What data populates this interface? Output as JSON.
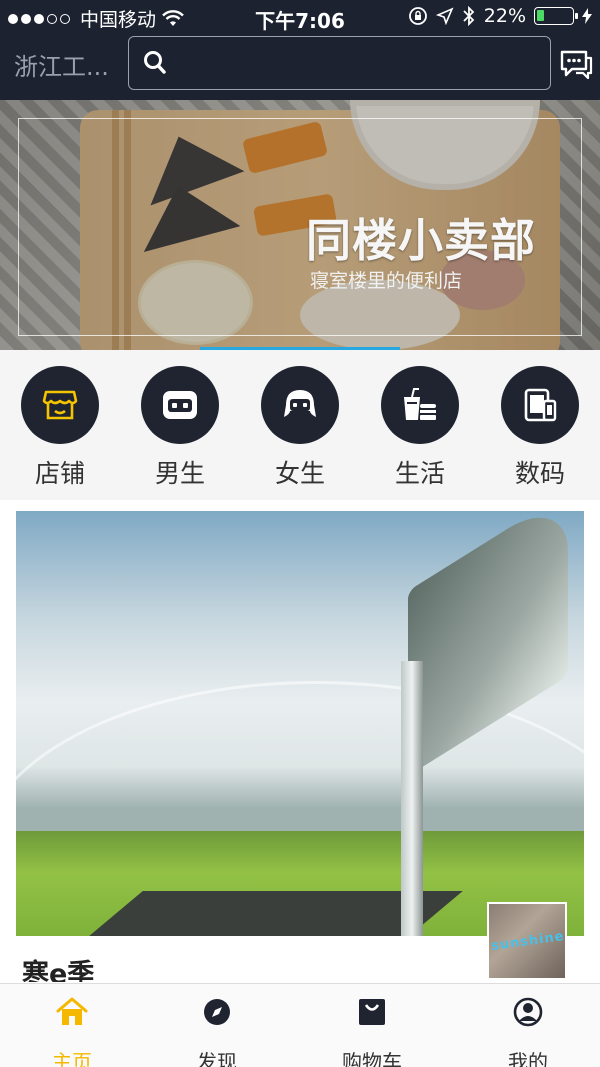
{
  "status_bar": {
    "carrier": "中国移动",
    "time": "下午7:06",
    "battery": "22%",
    "battery_level": 0.22
  },
  "header": {
    "school": "浙江工...",
    "search_placeholder": ""
  },
  "banner": {
    "title": "同楼小卖部",
    "subtitle": "寝室楼里的便利店"
  },
  "categories": [
    {
      "label": "店铺",
      "icon": "store-icon"
    },
    {
      "label": "男生",
      "icon": "boy-icon"
    },
    {
      "label": "女生",
      "icon": "girl-icon"
    },
    {
      "label": "生活",
      "icon": "life-icon"
    },
    {
      "label": "数码",
      "icon": "digital-icon"
    }
  ],
  "feed": {
    "title": "寒e季",
    "thumb_text": "sunshine"
  },
  "tabbar": [
    {
      "label": "主页",
      "icon": "home-icon",
      "active": true
    },
    {
      "label": "发现",
      "icon": "compass-icon",
      "active": false
    },
    {
      "label": "购物车",
      "icon": "bag-icon",
      "active": false
    },
    {
      "label": "我的",
      "icon": "user-icon",
      "active": false
    }
  ],
  "colors": {
    "header_bg": "#1d2230",
    "accent": "#f5b800",
    "indicator": "#28a8e0"
  }
}
